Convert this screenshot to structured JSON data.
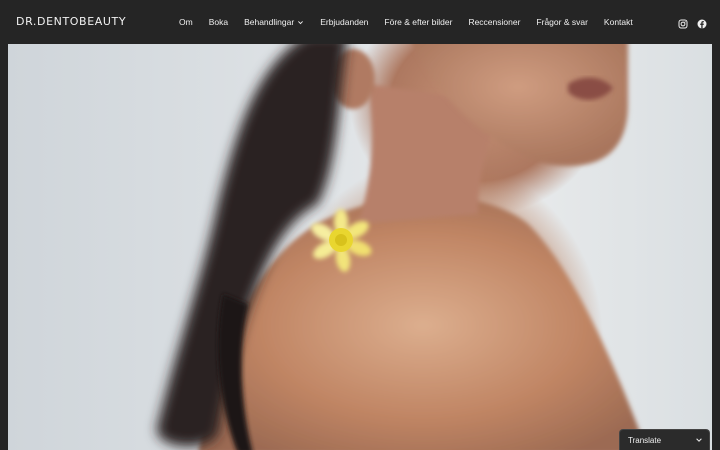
{
  "site": {
    "logo": "DR.DENTOBEAUTY"
  },
  "nav": {
    "items": [
      {
        "label": "Om"
      },
      {
        "label": "Boka"
      },
      {
        "label": "Behandlingar"
      },
      {
        "label": "Erbjudanden"
      },
      {
        "label": "Före & efter bilder"
      },
      {
        "label": "Reccensioner"
      },
      {
        "label": "Frågor & svar"
      },
      {
        "label": "Kontakt"
      }
    ]
  },
  "social": {
    "icons": [
      "instagram-icon",
      "facebook-icon"
    ]
  },
  "translate": {
    "label": "Translate"
  },
  "colors": {
    "header_bg": "#252525",
    "text": "#f0f0f0",
    "flower": "#f0e24a"
  }
}
